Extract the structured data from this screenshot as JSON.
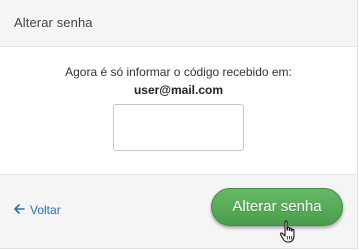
{
  "header": {
    "title": "Alterar senha"
  },
  "body": {
    "instruction": "Agora é só informar o código recebido em:",
    "email": "user@mail.com",
    "code_input": {
      "value": "",
      "placeholder": ""
    }
  },
  "footer": {
    "back_arrow": "🡐",
    "back_label": "Voltar",
    "submit_label": "Alterar senha"
  },
  "colors": {
    "header_bg": "#f5f5f5",
    "link": "#2a6fb6",
    "submit_bg": "#55a955"
  },
  "icons": {
    "back": "arrow-left-icon",
    "cursor": "hand-pointer-cursor-icon"
  }
}
